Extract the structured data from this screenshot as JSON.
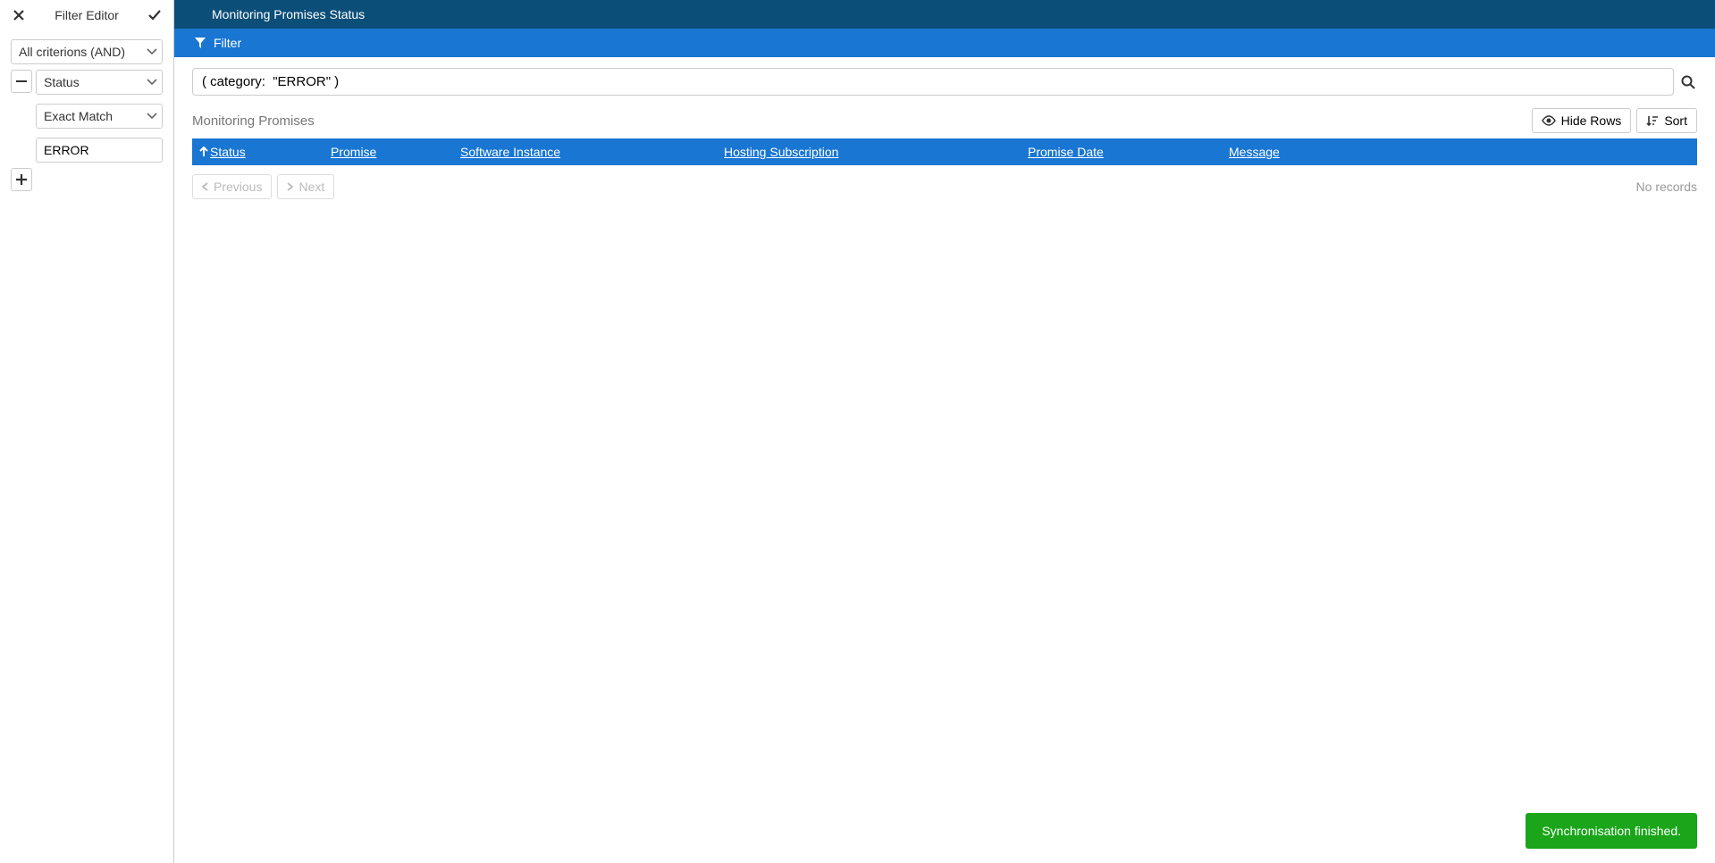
{
  "sidebar": {
    "title": "Filter Editor",
    "criterion_mode": "All criterions (AND)",
    "filters": [
      {
        "field": "Status",
        "match": "Exact Match",
        "value": "ERROR"
      }
    ]
  },
  "header": {
    "title": "Monitoring Promises Status",
    "subbar_label": "Filter"
  },
  "search": {
    "value": "( category:  \"ERROR\" )"
  },
  "table": {
    "section_label": "Monitoring Promises",
    "hide_rows_label": "Hide Rows",
    "sort_label": "Sort",
    "columns": {
      "status": "Status",
      "promise": "Promise",
      "software": "Software Instance",
      "hosting": "Hosting Subscription",
      "date": "Promise Date",
      "message": "Message"
    },
    "sorted_column": "status",
    "rows": []
  },
  "pager": {
    "previous": "Previous",
    "next": "Next",
    "no_records": "No records"
  },
  "toast": {
    "message": "Synchronisation finished."
  }
}
